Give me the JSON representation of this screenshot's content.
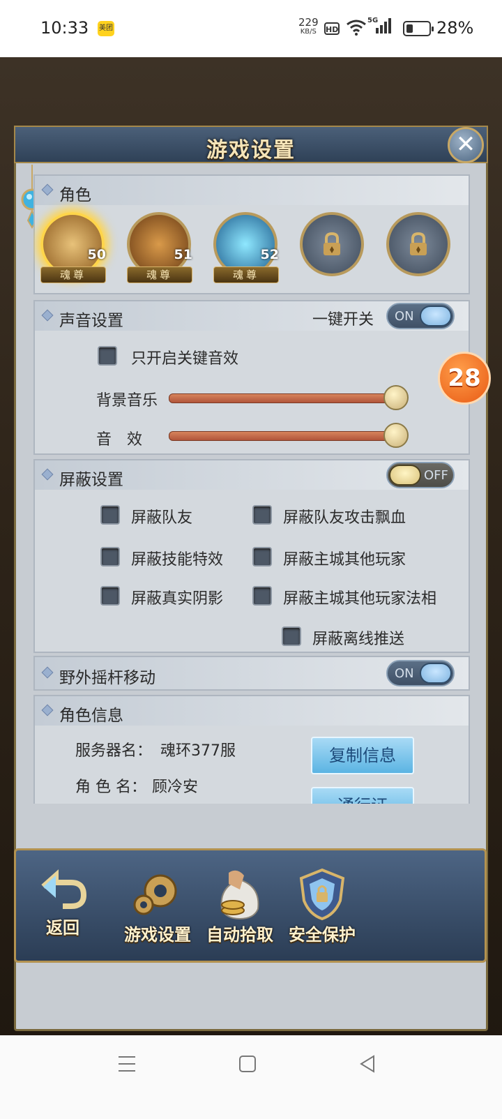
{
  "status_bar": {
    "time": "10:33",
    "app_badge": "美团",
    "speed_value": "229",
    "speed_unit": "KB/S",
    "hd": "HD",
    "network": "5G",
    "battery_pct": "28%"
  },
  "dialog": {
    "title": "游戏设置"
  },
  "roles": {
    "title": "角色",
    "items": [
      {
        "level": "50",
        "rank": "魂尊",
        "locked": false
      },
      {
        "level": "51",
        "rank": "魂尊",
        "locked": false
      },
      {
        "level": "52",
        "rank": "魂尊",
        "locked": false
      },
      {
        "locked": true
      },
      {
        "locked": true
      }
    ]
  },
  "sound": {
    "title": "声音设置",
    "master_label": "一键开关",
    "master_state": "ON",
    "key_sfx_only": "只开启关键音效",
    "bgm_label": "背景音乐",
    "sfx_label": "音　效",
    "bgm_level": 1.0,
    "sfx_level": 1.0
  },
  "shield": {
    "title": "屏蔽设置",
    "state": "OFF",
    "options": [
      "屏蔽队友",
      "屏蔽队友攻击飘血",
      "屏蔽技能特效",
      "屏蔽主城其他玩家",
      "屏蔽真实阴影",
      "屏蔽主城其他玩家法相",
      "屏蔽离线推送"
    ]
  },
  "joystick": {
    "title": "野外摇杆移动",
    "state": "ON"
  },
  "role_info": {
    "title": "角色信息",
    "server_label": "服务器名：",
    "server_value": "魂环377服",
    "name_label": "角 色 名：",
    "name_value": "顾冷安",
    "copy_button": "复制信息",
    "pass_button": "通行证"
  },
  "bottom_nav": {
    "back": "返回",
    "settings": "游戏设置",
    "auto_pickup": "自动拾取",
    "security": "安全保护"
  },
  "floating_badge": "28"
}
